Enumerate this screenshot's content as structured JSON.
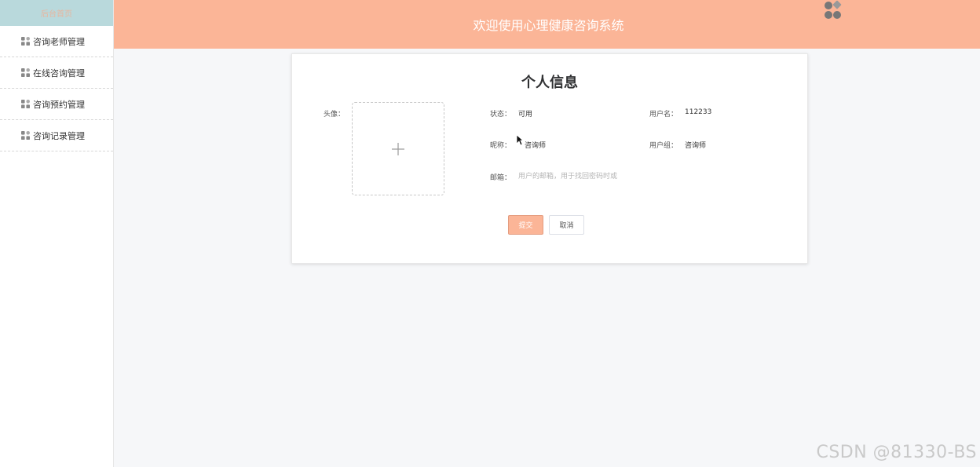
{
  "sidebar": {
    "header_label": "后台首页",
    "items": [
      {
        "label": "咨询老师管理",
        "icon": "grid-icon"
      },
      {
        "label": "在线咨询管理",
        "icon": "grid-icon"
      },
      {
        "label": "咨询预约管理",
        "icon": "grid-icon"
      },
      {
        "label": "咨询记录管理",
        "icon": "grid-icon"
      }
    ]
  },
  "header": {
    "title": "欢迎使用心理健康咨询系统",
    "avatar_icon": "user-avatar-icon"
  },
  "profile": {
    "title": "个人信息",
    "avatar_label": "头像：",
    "upload_icon": "plus-icon",
    "status_label": "状态：",
    "status_value": "可用",
    "username_label": "用户名：",
    "username_value": "112233",
    "nickname_label": "昵称：",
    "nickname_value": "咨询师",
    "group_label": "用户组：",
    "group_value": "咨询师",
    "email_label": "邮箱：",
    "email_value": "",
    "email_placeholder": "用户的邮箱，用于找回密码时或",
    "submit_label": "提交",
    "cancel_label": "取消"
  },
  "watermark": "CSDN @81330-BS",
  "colors": {
    "accent": "#fbb597",
    "sidebar_head": "#b9d9dc"
  }
}
